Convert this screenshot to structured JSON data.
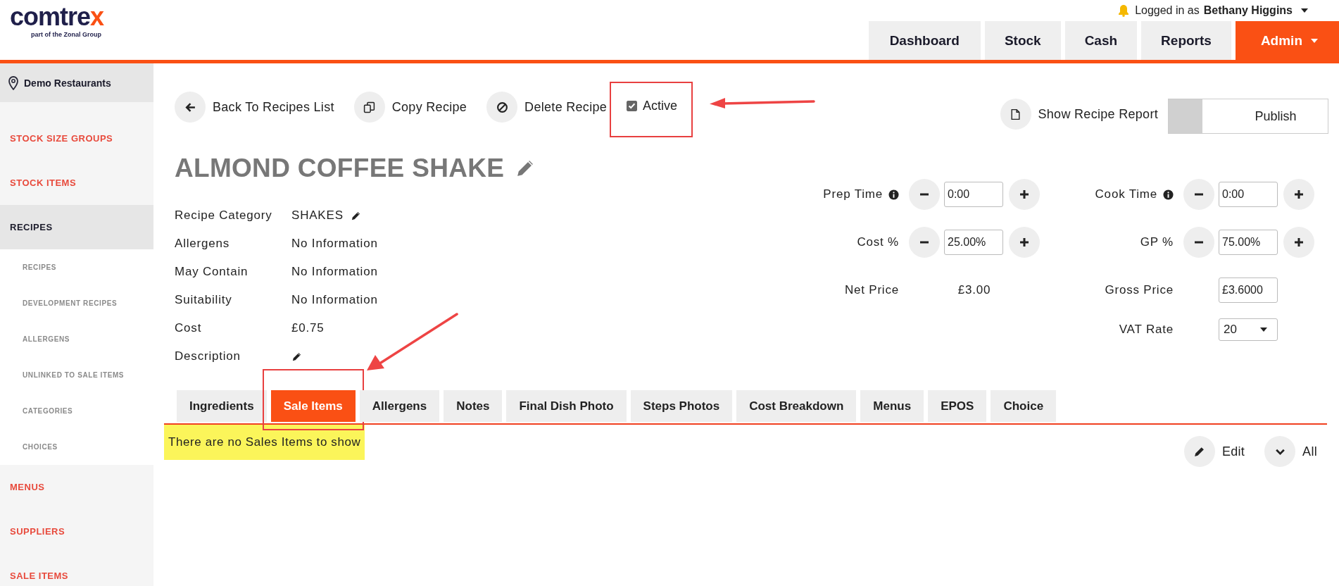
{
  "header": {
    "logo": "comtrex",
    "tagline": "part of the Zonal Group",
    "user_prefix": "Logged in as",
    "user_name": "Bethany Higgins",
    "nav": [
      {
        "label": "Dashboard",
        "selected": false
      },
      {
        "label": "Stock",
        "selected": false
      },
      {
        "label": "Cash",
        "selected": false
      },
      {
        "label": "Reports",
        "selected": false
      },
      {
        "label": "Admin",
        "selected": true
      }
    ]
  },
  "sidebar": {
    "location": "Demo Restaurants",
    "items": [
      {
        "label": "STOCK SIZE GROUPS",
        "selected": false
      },
      {
        "label": "STOCK ITEMS",
        "selected": false
      },
      {
        "label": "RECIPES",
        "selected": true,
        "children": [
          {
            "label": "RECIPES"
          },
          {
            "label": "DEVELOPMENT RECIPES"
          },
          {
            "label": "ALLERGENS"
          },
          {
            "label": "UNLINKED TO SALE ITEMS"
          },
          {
            "label": "CATEGORIES"
          },
          {
            "label": "CHOICES"
          }
        ]
      },
      {
        "label": "MENUS",
        "selected": false
      },
      {
        "label": "SUPPLIERS",
        "selected": false
      },
      {
        "label": "SALE ITEMS",
        "selected": false
      }
    ]
  },
  "actions": [
    {
      "kind": "back",
      "label": "Back To Recipes List"
    },
    {
      "kind": "copy",
      "label": "Copy Recipe"
    },
    {
      "kind": "delete",
      "label": "Delete Recipe"
    }
  ],
  "active_checkbox": {
    "label": "Active",
    "checked": true,
    "annotated": true
  },
  "report_button": "Show Recipe Report",
  "publish_toggle": {
    "label": "Publish",
    "on": false
  },
  "recipe": {
    "title": "ALMOND COFFEE SHAKE",
    "details": [
      {
        "label": "Recipe Category",
        "value": "SHAKES",
        "editable": true
      },
      {
        "label": "Allergens",
        "value": "No Information",
        "editable": false
      },
      {
        "label": "May Contain",
        "value": "No Information",
        "editable": false
      },
      {
        "label": "Suitability",
        "value": "No Information",
        "editable": false
      },
      {
        "label": "Cost",
        "value": "£0.75",
        "editable": false
      },
      {
        "label": "Description",
        "editable": true
      }
    ]
  },
  "pricing_rows": [
    {
      "left": {
        "kind": "stepper",
        "label": "Prep Time",
        "info": true,
        "value": "0:00"
      },
      "right": {
        "kind": "stepper",
        "label": "Cook Time",
        "info": true,
        "value": "0:00"
      }
    },
    {
      "left": {
        "kind": "stepper",
        "label": "Cost %",
        "info": false,
        "value": "25.00%"
      },
      "right": {
        "kind": "stepper",
        "label": "GP %",
        "info": false,
        "value": "75.00%"
      }
    },
    {
      "left": {
        "kind": "text",
        "label": "Net Price",
        "value": "£3.00"
      },
      "right": {
        "kind": "input",
        "label": "Gross Price",
        "value": "£3.6000"
      }
    },
    {
      "right": {
        "kind": "select",
        "label": "VAT Rate",
        "value": "20"
      }
    }
  ],
  "tabs": [
    {
      "label": "Ingredients",
      "selected": false
    },
    {
      "label": "Sale Items",
      "selected": true,
      "annotated": true
    },
    {
      "label": "Allergens",
      "selected": false
    },
    {
      "label": "Notes",
      "selected": false
    },
    {
      "label": "Final Dish Photo",
      "selected": false
    },
    {
      "label": "Steps Photos",
      "selected": false
    },
    {
      "label": "Cost Breakdown",
      "selected": false
    },
    {
      "label": "Menus",
      "selected": false
    },
    {
      "label": "EPOS",
      "selected": false
    },
    {
      "label": "Choice",
      "selected": false
    }
  ],
  "message": {
    "text": "There are no Sales Items to show",
    "highlighted": true
  },
  "tab_buttons": [
    {
      "kind": "edit",
      "label": "Edit"
    },
    {
      "kind": "expand",
      "label": "All"
    }
  ]
}
